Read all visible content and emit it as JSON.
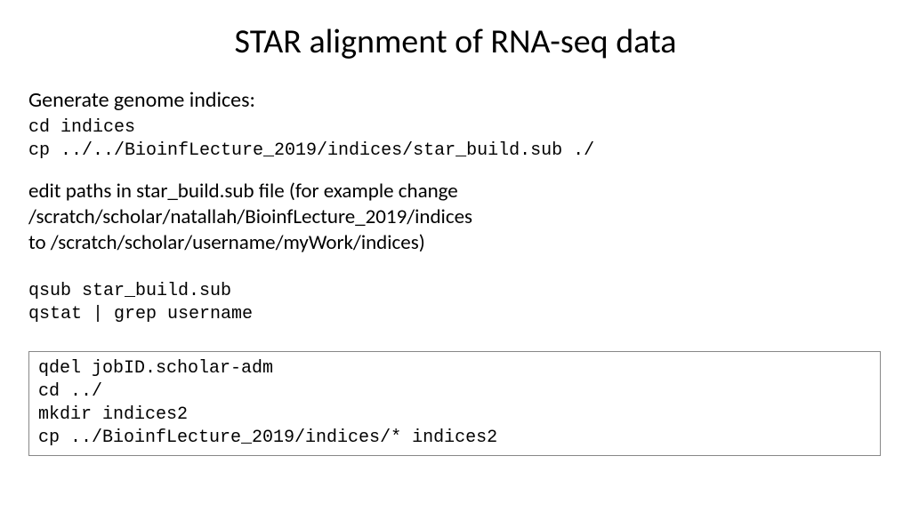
{
  "title": "STAR alignment of RNA-seq data",
  "subheading": "Generate genome indices:",
  "code_block_1": {
    "line1": "cd indices",
    "line2": "cp ../../BioinfLecture_2019/indices/star_build.sub ./"
  },
  "body": {
    "line1": "edit paths in star_build.sub file (for example change /scratch/scholar/natallah/BioinfLecture_2019/indices",
    "line2": "to /scratch/scholar/username/myWork/indices)"
  },
  "code_block_2": {
    "line1": "qsub star_build.sub",
    "line2": "qstat | grep username"
  },
  "code_box": {
    "line1": "qdel jobID.scholar-adm",
    "line2": "cd ../",
    "line3": "mkdir indices2",
    "line4": "cp ../BioinfLecture_2019/indices/* indices2"
  }
}
